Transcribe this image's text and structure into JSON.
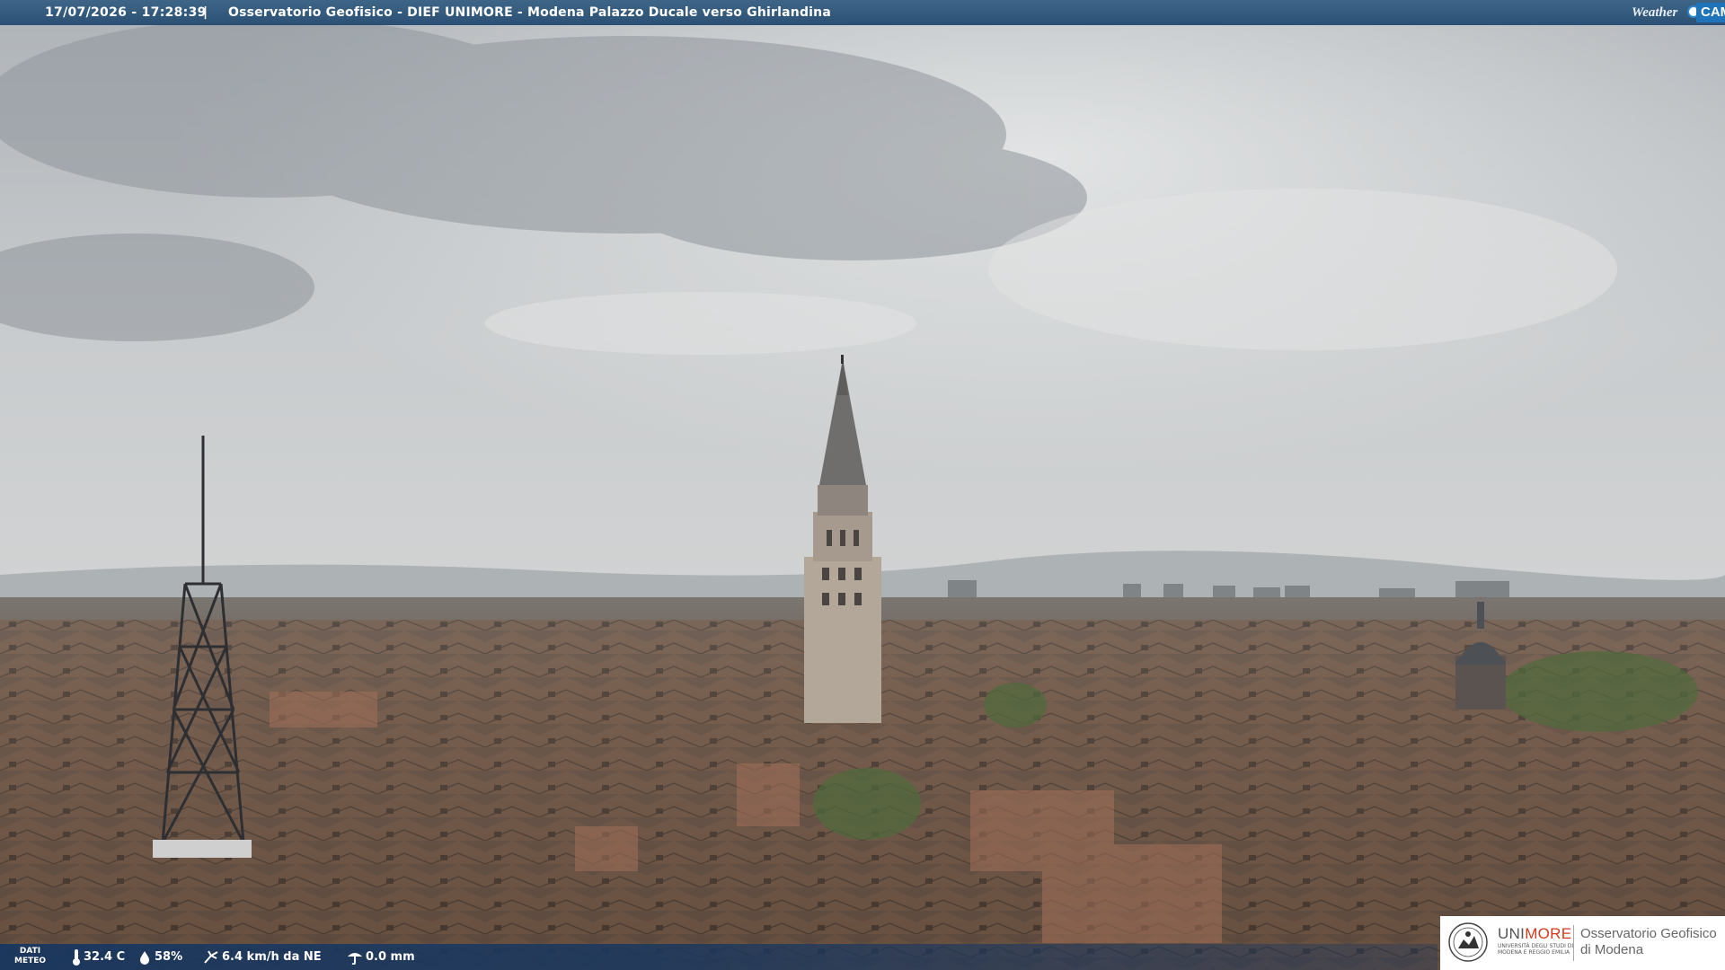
{
  "header": {
    "datetime": "17/07/2026 - 17:28:39",
    "separator": "|",
    "title": "Osservatorio Geofisico - DIEF UNIMORE - Modena Palazzo Ducale verso Ghirlandina",
    "brand_weather": "Weather",
    "brand_cam": "CAM"
  },
  "weather": {
    "label_line1": "DATI",
    "label_line2": "METEO",
    "temperature": "32.4 C",
    "humidity": "58%",
    "wind": "6.4 km/h da NE",
    "rain": "0.0 mm",
    "icons": [
      "thermometer-icon",
      "humidity-drop-icon",
      "wind-icon",
      "rain-gauge-icon"
    ]
  },
  "logo": {
    "uni_a": "UNI",
    "uni_b": "MORE",
    "uni_sub1": "UNIVERSITÀ DEGLI STUDI DI",
    "uni_sub2": "MODENA E REGGIO EMILIA",
    "obs_line1": "Osservatorio Geofisico",
    "obs_line2": "di Modena"
  },
  "colors": {
    "bar_blue": "#2b5073",
    "brand_red": "#d23a1f",
    "brand_blue": "#1f73b8"
  }
}
